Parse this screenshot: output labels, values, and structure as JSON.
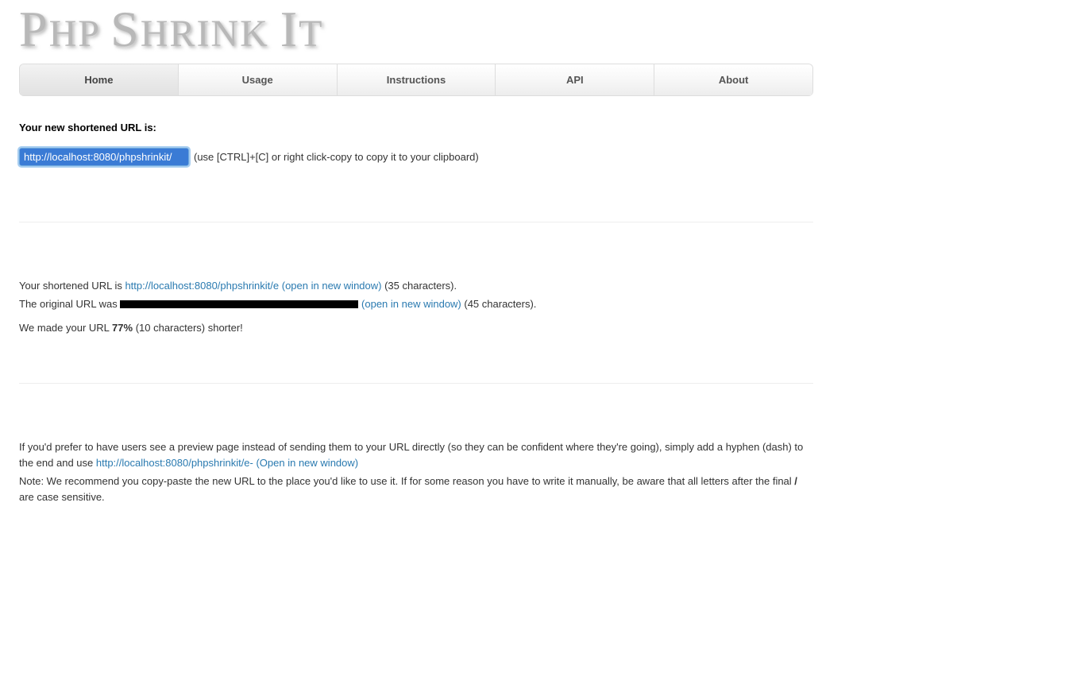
{
  "logo": {
    "text": "PHP SHRINK IT"
  },
  "tabs": {
    "items": [
      {
        "label": "Home",
        "active": true
      },
      {
        "label": "Usage",
        "active": false
      },
      {
        "label": "Instructions",
        "active": false
      },
      {
        "label": "API",
        "active": false
      },
      {
        "label": "About",
        "active": false
      }
    ]
  },
  "result": {
    "heading": "Your new shortened URL is:",
    "url_value": "http://localhost:8080/phpshrinkit/",
    "copy_hint": "(use [CTRL]+[C] or right click-copy to copy it to your clipboard)"
  },
  "info": {
    "shortened_prefix": "Your shortened URL is ",
    "shortened_link": "http://localhost:8080/phpshrinkit/e (open in new window)",
    "shortened_suffix": " (35 characters).",
    "original_prefix": "The original URL was ",
    "original_link": "(open in new window)",
    "original_suffix": " (45 characters).",
    "summary_prefix": "We made your URL ",
    "summary_percent": "77%",
    "summary_suffix": " (10 characters) shorter!"
  },
  "tips": {
    "preview_prefix": "If you'd prefer to have users see a preview page instead of sending them to your URL directly (so they can be confident where they're going), simply add a hyphen (dash) to the end and use ",
    "preview_link": "http://localhost:8080/phpshrinkit/e- (Open in new window)",
    "note_prefix": "Note: We recommend you copy-paste the new URL to the place you'd like to use it. If for some reason you have to write it manually, be aware that all letters after the final ",
    "note_slash": "/",
    "note_suffix": " are case sensitive."
  }
}
